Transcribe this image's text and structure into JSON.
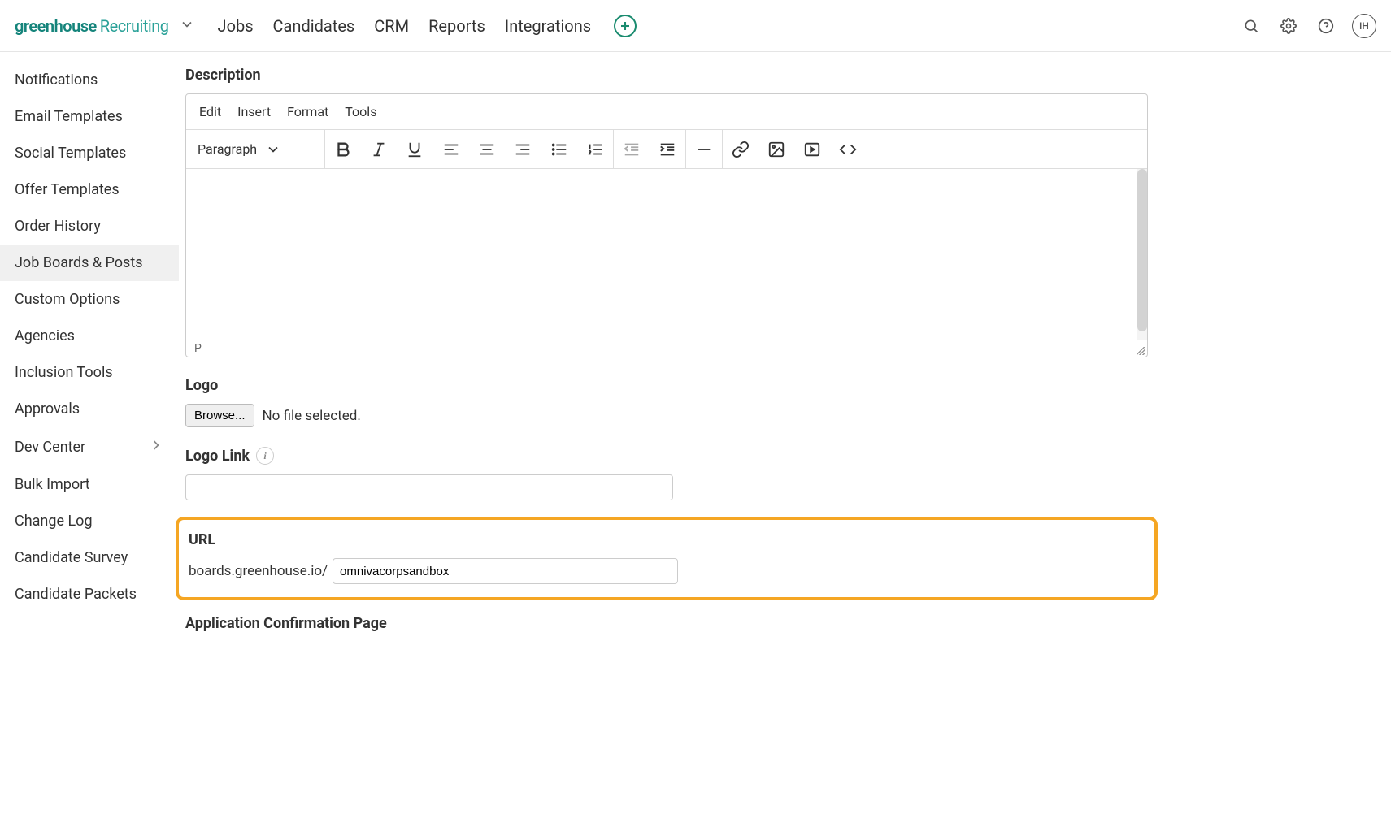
{
  "header": {
    "logo_part1": "greenhouse",
    "logo_part2": "Recruiting",
    "nav": [
      "Jobs",
      "Candidates",
      "CRM",
      "Reports",
      "Integrations"
    ],
    "avatar_initials": "IH"
  },
  "sidebar": {
    "items": [
      {
        "label": "Notifications"
      },
      {
        "label": "Email Templates"
      },
      {
        "label": "Social Templates"
      },
      {
        "label": "Offer Templates"
      },
      {
        "label": "Order History"
      },
      {
        "label": "Job Boards & Posts",
        "active": true
      },
      {
        "label": "Custom Options"
      },
      {
        "label": "Agencies"
      },
      {
        "label": "Inclusion Tools"
      },
      {
        "label": "Approvals"
      },
      {
        "label": "Dev Center",
        "has_submenu": true
      },
      {
        "label": "Bulk Import"
      },
      {
        "label": "Change Log"
      },
      {
        "label": "Candidate Survey"
      },
      {
        "label": "Candidate Packets"
      }
    ]
  },
  "editor": {
    "section_title": "Description",
    "menus": [
      "Edit",
      "Insert",
      "Format",
      "Tools"
    ],
    "block_format": "Paragraph",
    "status_path": "P"
  },
  "logo_section": {
    "title": "Logo",
    "browse_label": "Browse...",
    "file_status": "No file selected."
  },
  "logo_link_section": {
    "title": "Logo Link",
    "value": ""
  },
  "url_section": {
    "title": "URL",
    "prefix": "boards.greenhouse.io/",
    "value": "omnivacorpsandbox"
  },
  "app_confirm_section": {
    "title": "Application Confirmation Page"
  }
}
